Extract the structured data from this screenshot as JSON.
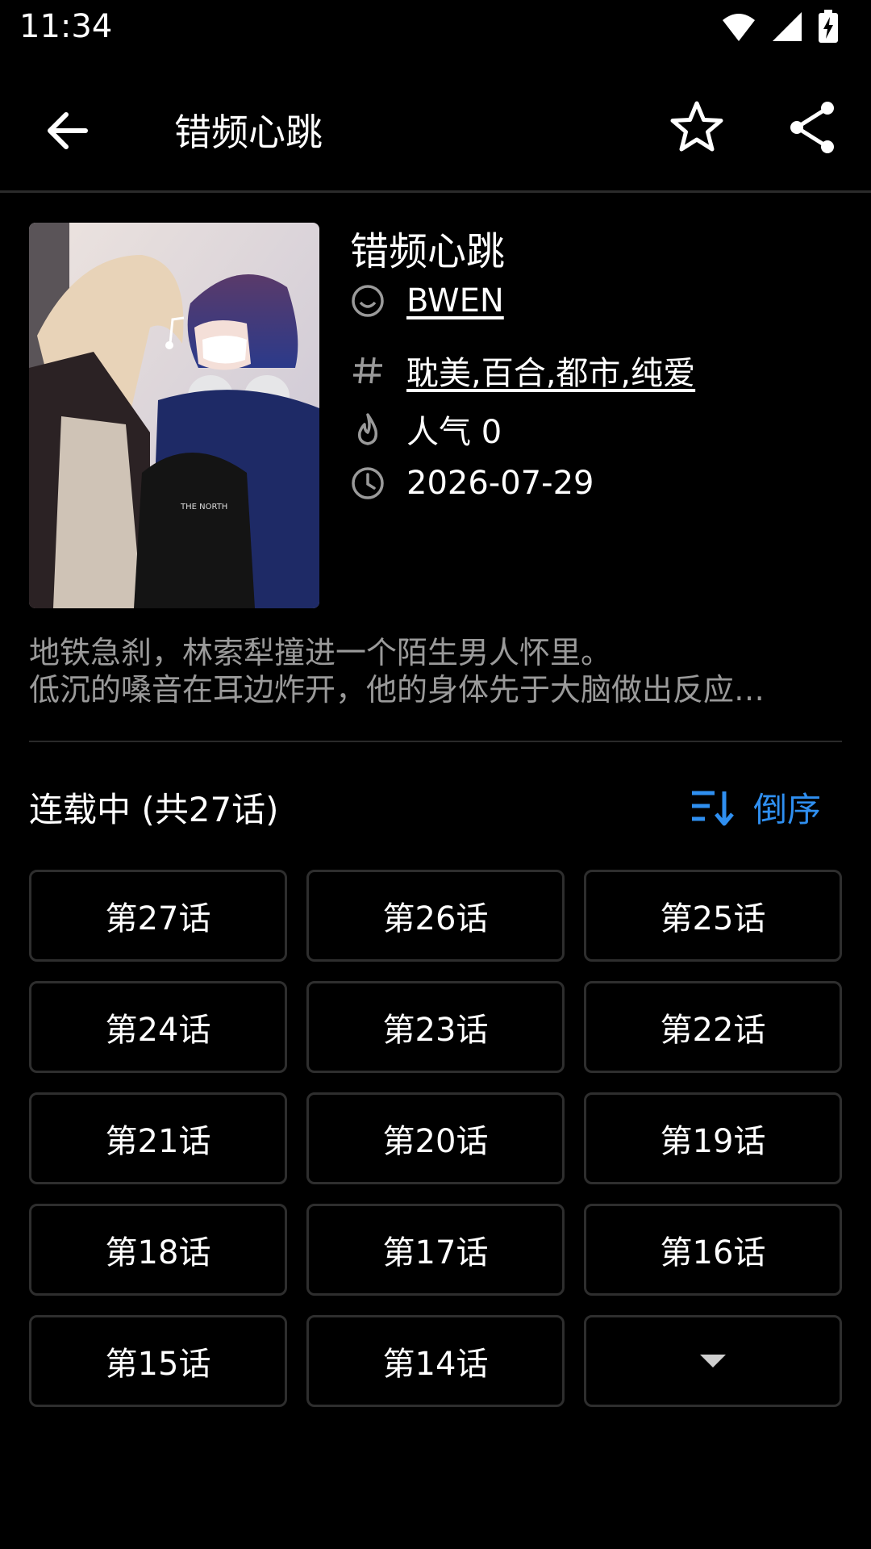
{
  "status_bar": {
    "time": "11:34"
  },
  "app_bar": {
    "title": "错频心跳"
  },
  "book": {
    "title": "错频心跳",
    "author": "BWEN",
    "tags": "耽美,百合,都市,纯爱",
    "popularity": "人气 0",
    "date": "2026-07-29"
  },
  "description": {
    "line1": "地铁急刹，林索犁撞进一个陌生男人怀里。",
    "line2": "低沉的嗓音在耳边炸开，他的身体先于大脑做出反应…"
  },
  "chapters_section": {
    "status": "连载中 (共27话)",
    "sort_label": "倒序"
  },
  "chapters": [
    "第27话",
    "第26话",
    "第25话",
    "第24话",
    "第23话",
    "第22话",
    "第21话",
    "第20话",
    "第19话",
    "第18话",
    "第17话",
    "第16话",
    "第15话",
    "第14话"
  ],
  "colors": {
    "accent": "#2f8ff0",
    "background": "#000000",
    "border": "#2e2e2e",
    "muted_text": "#9a9a9a"
  }
}
